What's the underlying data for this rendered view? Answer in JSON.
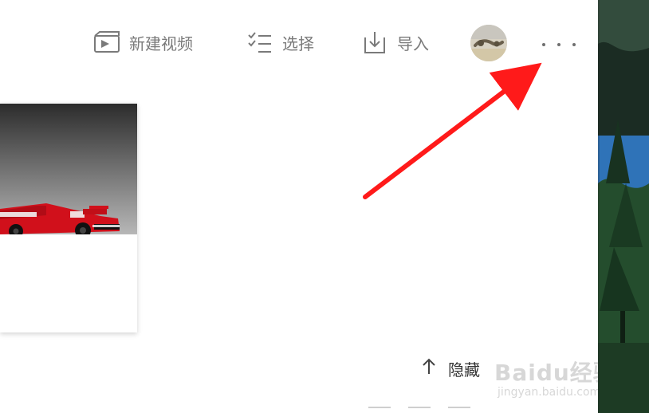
{
  "toolbar": {
    "new_video_label": "新建视频",
    "select_label": "选择",
    "import_label": "导入"
  },
  "footer": {
    "hide_label": "隐藏"
  },
  "watermark": {
    "main": "Baidu经验",
    "sub": "jingyan.baidu.com"
  },
  "colors": {
    "toolbar_text": "#7a7a7a",
    "arrow_red": "#ff1a1a",
    "background": "#ffffff"
  },
  "icons": {
    "new_video": "video-clapper-icon",
    "select": "checklist-icon",
    "import": "import-tray-icon",
    "more": "more-horizontal-icon",
    "hide": "arrow-up-icon"
  }
}
